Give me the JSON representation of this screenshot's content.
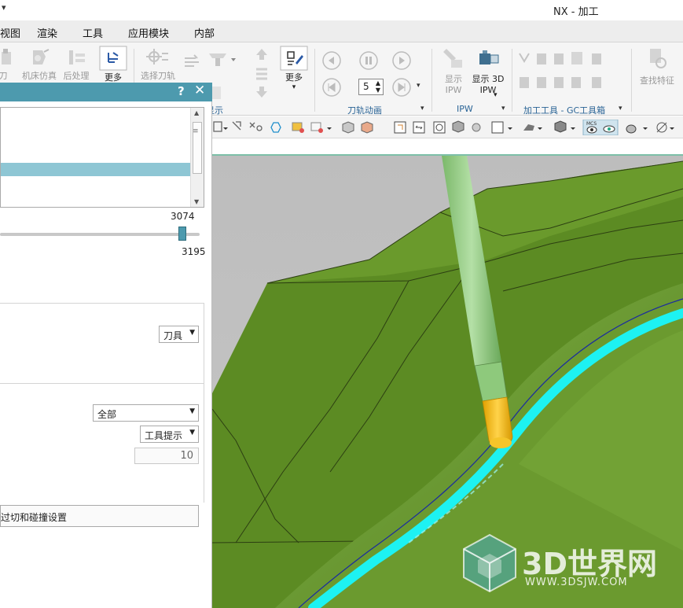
{
  "titlebar": {
    "quick_access": "▾",
    "title": "NX - 加工"
  },
  "menu": {
    "items": [
      "视图",
      "渲染",
      "工具",
      "应用模块",
      "内部"
    ]
  },
  "ribbon": {
    "buttons": [
      {
        "label": "刀轨",
        "enabled": false
      },
      {
        "label": "机床仿真",
        "enabled": false
      },
      {
        "label": "后处理",
        "enabled": false
      },
      {
        "label": "更多",
        "enabled": true
      },
      {
        "label": "选择刀轨",
        "enabled": false
      },
      {
        "label": "更多",
        "enabled": true
      },
      {
        "label": "显示 IPW",
        "enabled": false
      },
      {
        "label": "显示 3D IPW",
        "enabled": true
      },
      {
        "label": "查找特征",
        "enabled": false
      }
    ],
    "step_value": "5",
    "groups": [
      "显示",
      "刀轨动画",
      "IPW",
      "加工工具 - GC工具箱"
    ]
  },
  "dialog": {
    "help": "?",
    "close": "✕",
    "slider_current": "3074",
    "slider_max": "3195",
    "slider_fraction": 0.962,
    "display_select": "刀具",
    "filter_select": "全部",
    "tooltip_select": "工具提示",
    "number_value": "10",
    "settings_button": "过切和碰撞设置"
  },
  "watermark": {
    "brand": "3D世界网",
    "url": "WWW.3DSJW.COM"
  },
  "colors": {
    "dialog_header": "#4d9aae",
    "part_green": "#5b8a22",
    "path_cyan": "#1df2f2",
    "tool_green": "#8ec97c",
    "tool_tip": "#f0b800"
  }
}
